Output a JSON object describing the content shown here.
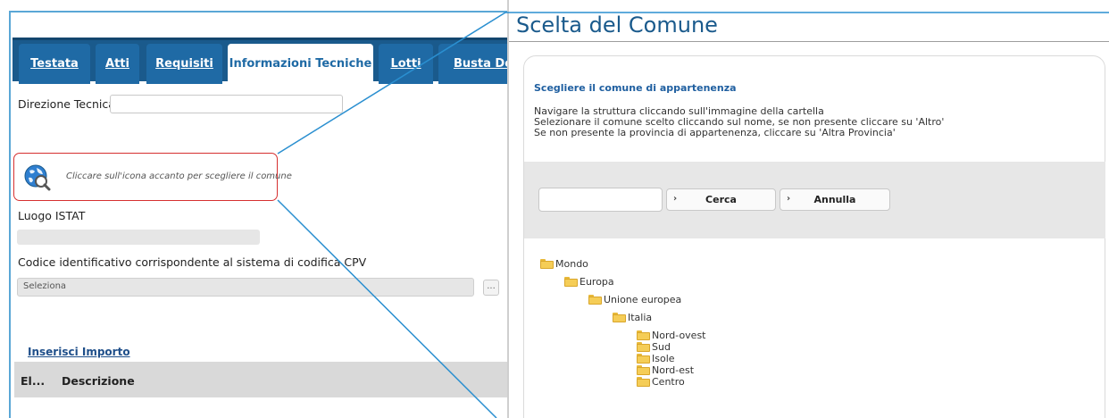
{
  "left": {
    "tabs": [
      {
        "label": "Testata",
        "active": false
      },
      {
        "label": "Atti",
        "active": false
      },
      {
        "label": "Requisiti",
        "active": false
      },
      {
        "label": "Informazioni Tecniche",
        "active": true
      },
      {
        "label": "Lotti",
        "active": false
      },
      {
        "label": "Busta Docu",
        "active": false
      }
    ],
    "direzione_tecnica_label": "Direzione Tecnica",
    "direzione_tecnica_value": "",
    "comune_hint": "Cliccare sull'icona accanto per scegliere il comune",
    "comune_icon": "globe-search-icon",
    "luogo_istat_label": "Luogo ISTAT",
    "luogo_istat_value": "",
    "cpv_label": "Codice identificativo corrispondente al sistema di codifica CPV",
    "cpv_select_value": "Seleziona",
    "cpv_more_label": "...",
    "inserisci_importo_link": "Inserisci Importo",
    "grid_columns": [
      "El...",
      "Descrizione"
    ]
  },
  "right": {
    "title": "Scelta del Comune",
    "heading": "Scegliere il comune di appartenenza",
    "instructions": [
      "Navigare la struttura cliccando sull'immagine della cartella",
      "Selezionare il comune scelto cliccando sul nome, se non presente cliccare su 'Altro'",
      "Se non presente la provincia di appartenenza, cliccare su 'Altra Provincia'"
    ],
    "search_value": "",
    "cerca_label": "Cerca",
    "annulla_label": "Annulla",
    "button_chevron": "›",
    "tree": [
      {
        "label": "Mondo",
        "level": 0
      },
      {
        "label": "Europa",
        "level": 1
      },
      {
        "label": "Unione europea",
        "level": 2
      },
      {
        "label": "Italia",
        "level": 3
      },
      {
        "label": "Nord-ovest",
        "level": 4
      },
      {
        "label": "Sud",
        "level": 4
      },
      {
        "label": "Isole",
        "level": 4
      },
      {
        "label": "Nord-est",
        "level": 4
      },
      {
        "label": "Centro",
        "level": 4
      }
    ]
  },
  "colors": {
    "tab_bg": "#1f6aa5",
    "title_blue": "#1a5a8c",
    "callout_line": "#2a8fd0",
    "highlight_border": "#d63030",
    "folder_yellow": "#f5cd57"
  }
}
